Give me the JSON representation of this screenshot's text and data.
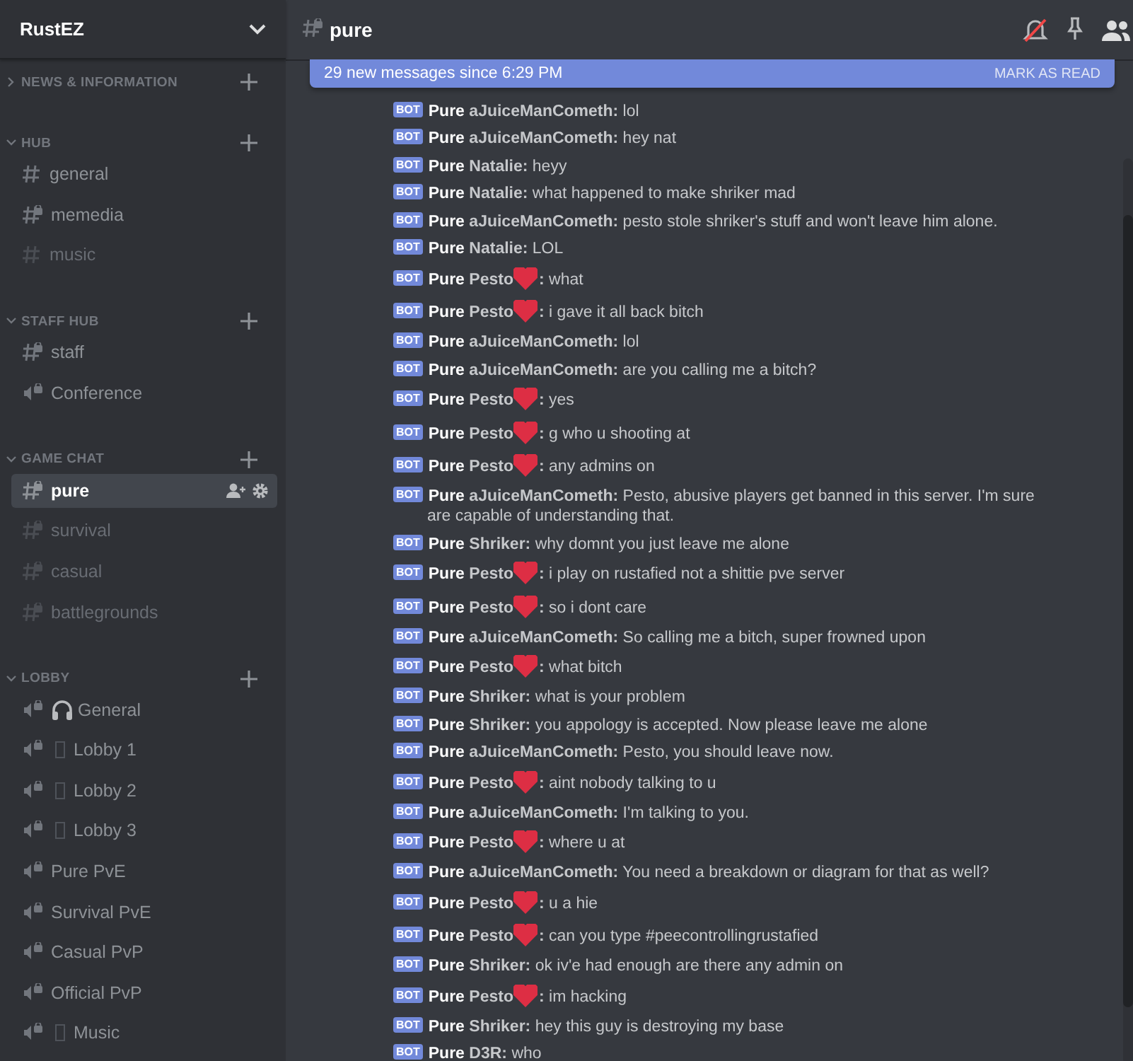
{
  "server": {
    "name": "RustEZ"
  },
  "categories": [
    {
      "name": "NEWS & INFORMATION",
      "expanded": false
    },
    {
      "name": "HUB",
      "expanded": true,
      "channels": [
        {
          "name": "general",
          "kind": "text",
          "muted": false,
          "selected": false
        },
        {
          "name": "memedia",
          "kind": "text-locked",
          "muted": false,
          "selected": false
        },
        {
          "name": "music",
          "kind": "text",
          "muted": true,
          "selected": false
        }
      ]
    },
    {
      "name": "STAFF HUB",
      "expanded": true,
      "channels": [
        {
          "name": "staff",
          "kind": "text-locked",
          "muted": false,
          "selected": false
        },
        {
          "name": "Conference",
          "kind": "voice-locked",
          "muted": false,
          "selected": false
        }
      ]
    },
    {
      "name": "GAME CHAT",
      "expanded": true,
      "channels": [
        {
          "name": "pure",
          "kind": "text-locked",
          "muted": false,
          "selected": true
        },
        {
          "name": "survival",
          "kind": "text-locked",
          "muted": true,
          "selected": false
        },
        {
          "name": "casual",
          "kind": "text-locked",
          "muted": true,
          "selected": false
        },
        {
          "name": "battlegrounds",
          "kind": "text-locked",
          "muted": true,
          "selected": false
        }
      ]
    },
    {
      "name": "LOBBY",
      "expanded": true,
      "channels": [
        {
          "name": "General",
          "kind": "voice-locked",
          "decoration": {
            "kind": "headphones"
          },
          "muted": false,
          "selected": false
        },
        {
          "name": "Lobby 1",
          "kind": "voice-locked",
          "decoration": {
            "kind": "missing-glyph"
          },
          "muted": false,
          "selected": false
        },
        {
          "name": "Lobby 2",
          "kind": "voice-locked",
          "decoration": {
            "kind": "missing-glyph"
          },
          "muted": false,
          "selected": false
        },
        {
          "name": "Lobby 3",
          "kind": "voice-locked",
          "decoration": {
            "kind": "missing-glyph"
          },
          "muted": false,
          "selected": false
        },
        {
          "name": "Pure PvE",
          "kind": "voice-locked",
          "muted": false,
          "selected": false
        },
        {
          "name": "Survival PvE",
          "kind": "voice-locked",
          "muted": false,
          "selected": false
        },
        {
          "name": "Casual PvP",
          "kind": "voice-locked",
          "muted": false,
          "selected": false
        },
        {
          "name": "Official PvP",
          "kind": "voice-locked",
          "muted": false,
          "selected": false
        },
        {
          "name": "Music",
          "kind": "voice-locked",
          "decoration": {
            "kind": "missing-glyph"
          },
          "muted": false,
          "selected": false
        }
      ]
    }
  ],
  "channel_header": {
    "name": "pure",
    "kind": "text-locked",
    "notifications_muted": true
  },
  "new_messages_bar": {
    "text": "29 new messages since 6:29 PM",
    "action": "MARK AS READ"
  },
  "messages": [
    {
      "tag": "BOT",
      "prefix": "Pure",
      "author": "aJuiceManCometh",
      "sep": ":",
      "text": "lol"
    },
    {
      "tag": "BOT",
      "prefix": "Pure",
      "author": "aJuiceManCometh",
      "sep": ":",
      "text": "hey nat"
    },
    {
      "tag": "BOT",
      "prefix": "Pure",
      "author": "Natalie",
      "sep": ":",
      "text": "heyy"
    },
    {
      "tag": "BOT",
      "prefix": "Pure",
      "author": "Natalie",
      "sep": ":",
      "text": "what happened to make shriker mad"
    },
    {
      "tag": "BOT",
      "prefix": "Pure",
      "author": "aJuiceManCometh",
      "sep": ":",
      "text": "pesto stole shriker's stuff and won't leave him alone."
    },
    {
      "tag": "BOT",
      "prefix": "Pure",
      "author": "Natalie",
      "sep": ":",
      "text": "LOL"
    },
    {
      "tag": "BOT",
      "prefix": "Pure",
      "author": "Pesto",
      "heart": true,
      "sep": ":",
      "text": "what"
    },
    {
      "tag": "BOT",
      "prefix": "Pure",
      "author": "Pesto",
      "heart": true,
      "sep": ":",
      "text": "i gave it all back bitch"
    },
    {
      "tag": "BOT",
      "prefix": "Pure",
      "author": "aJuiceManCometh",
      "sep": ":",
      "text": "lol"
    },
    {
      "tag": "BOT",
      "prefix": "Pure",
      "author": "aJuiceManCometh",
      "sep": ":",
      "text": "are you calling me a bitch?"
    },
    {
      "tag": "BOT",
      "prefix": "Pure",
      "author": "Pesto",
      "heart": true,
      "sep": ":",
      "text": "yes"
    },
    {
      "tag": "BOT",
      "prefix": "Pure",
      "author": "Pesto",
      "heart": true,
      "sep": ":",
      "text": "g who u shooting at"
    },
    {
      "tag": "BOT",
      "prefix": "Pure",
      "author": "Pesto",
      "heart": true,
      "sep": ":",
      "text": "any admins on"
    },
    {
      "tag": "BOT",
      "prefix": "Pure",
      "author": "aJuiceManCometh",
      "sep": ":",
      "text": "Pesto, abusive players get banned in this server. I'm sure are capable of understanding that."
    },
    {
      "tag": "BOT",
      "prefix": "Pure",
      "author": "Shriker",
      "sep": ":",
      "text": "why domnt you just leave me alone"
    },
    {
      "tag": "BOT",
      "prefix": "Pure",
      "author": "Pesto",
      "heart": true,
      "sep": ":",
      "text": "i play on rustafied not a shittie pve server"
    },
    {
      "tag": "BOT",
      "prefix": "Pure",
      "author": "Pesto",
      "heart": true,
      "sep": ":",
      "text": "so i dont care"
    },
    {
      "tag": "BOT",
      "prefix": "Pure",
      "author": "aJuiceManCometh",
      "sep": ":",
      "text": "So calling me a bitch, super frowned upon"
    },
    {
      "tag": "BOT",
      "prefix": "Pure",
      "author": "Pesto",
      "heart": true,
      "sep": ":",
      "text": "what bitch"
    },
    {
      "tag": "BOT",
      "prefix": "Pure",
      "author": "Shriker",
      "sep": ":",
      "text": "what is your problem"
    },
    {
      "tag": "BOT",
      "prefix": "Pure",
      "author": "Shriker",
      "sep": ":",
      "text": "you appology is accepted.  Now please leave me alone"
    },
    {
      "tag": "BOT",
      "prefix": "Pure",
      "author": "aJuiceManCometh",
      "sep": ":",
      "text": "Pesto, you should leave now."
    },
    {
      "tag": "BOT",
      "prefix": "Pure",
      "author": "Pesto",
      "heart": true,
      "sep": ":",
      "text": "aint nobody talking to u"
    },
    {
      "tag": "BOT",
      "prefix": "Pure",
      "author": "aJuiceManCometh",
      "sep": ":",
      "text": "I'm talking to you."
    },
    {
      "tag": "BOT",
      "prefix": "Pure",
      "author": "Pesto",
      "heart": true,
      "sep": ":",
      "text": "where u at"
    },
    {
      "tag": "BOT",
      "prefix": "Pure",
      "author": "aJuiceManCometh",
      "sep": ":",
      "text": "You need a breakdown or diagram for that as well?"
    },
    {
      "tag": "BOT",
      "prefix": "Pure",
      "author": "Pesto",
      "heart": true,
      "sep": ":",
      "text": "u a hie"
    },
    {
      "tag": "BOT",
      "prefix": "Pure",
      "author": "Pesto",
      "heart": true,
      "sep": ":",
      "text": "can you type #peecontrollingrustafied"
    },
    {
      "tag": "BOT",
      "prefix": "Pure",
      "author": "Shriker",
      "sep": ":",
      "text": "ok iv'e had enough are there any admin on"
    },
    {
      "tag": "BOT",
      "prefix": "Pure",
      "author": "Pesto",
      "heart": true,
      "sep": ":",
      "text": "im hacking"
    },
    {
      "tag": "BOT",
      "prefix": "Pure",
      "author": "Shriker",
      "sep": ":",
      "text": "hey this guy is destroying my base"
    },
    {
      "tag": "BOT",
      "prefix": "Pure",
      "author": "D3R",
      "sep": ":",
      "text": "who"
    }
  ]
}
